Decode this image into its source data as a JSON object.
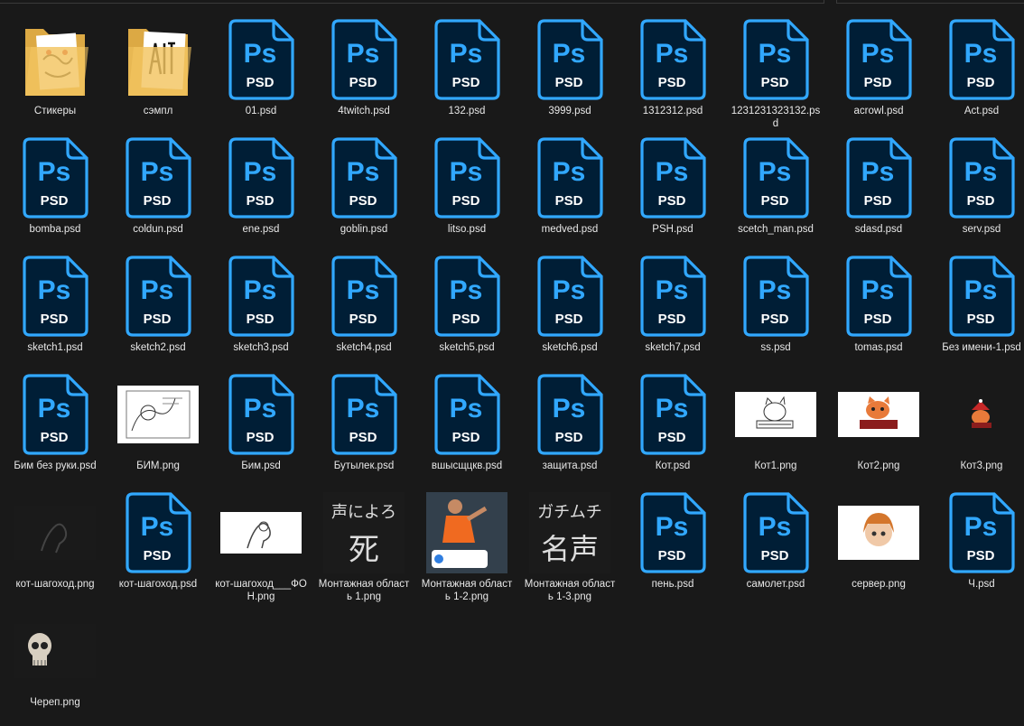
{
  "items": [
    {
      "kind": "folder",
      "variant": "stickers",
      "name": "Стикеры"
    },
    {
      "kind": "folder",
      "variant": "sample",
      "name": "сэмпл"
    },
    {
      "kind": "psd",
      "name": "01.psd"
    },
    {
      "kind": "psd",
      "name": "4twitch.psd"
    },
    {
      "kind": "psd",
      "name": "132.psd"
    },
    {
      "kind": "psd",
      "name": "3999.psd"
    },
    {
      "kind": "psd",
      "name": "1312312.psd"
    },
    {
      "kind": "psd",
      "name": "1231231323132.psd"
    },
    {
      "kind": "psd",
      "name": "acrowl.psd"
    },
    {
      "kind": "psd",
      "name": "Act.psd"
    },
    {
      "kind": "psd",
      "name": "bomba.psd"
    },
    {
      "kind": "psd",
      "name": "coldun.psd"
    },
    {
      "kind": "psd",
      "name": "ene.psd"
    },
    {
      "kind": "psd",
      "name": "goblin.psd"
    },
    {
      "kind": "psd",
      "name": "litso.psd"
    },
    {
      "kind": "psd",
      "name": "medved.psd"
    },
    {
      "kind": "psd",
      "name": "PSH.psd"
    },
    {
      "kind": "psd",
      "name": "scetch_man.psd"
    },
    {
      "kind": "psd",
      "name": "sdasd.psd"
    },
    {
      "kind": "psd",
      "name": "serv.psd"
    },
    {
      "kind": "psd",
      "name": "sketch1.psd"
    },
    {
      "kind": "psd",
      "name": "sketch2.psd"
    },
    {
      "kind": "psd",
      "name": "sketch3.psd"
    },
    {
      "kind": "psd",
      "name": "sketch4.psd"
    },
    {
      "kind": "psd",
      "name": "sketch5.psd"
    },
    {
      "kind": "psd",
      "name": "sketch6.psd"
    },
    {
      "kind": "psd",
      "name": "sketch7.psd"
    },
    {
      "kind": "psd",
      "name": "ss.psd"
    },
    {
      "kind": "psd",
      "name": "tomas.psd"
    },
    {
      "kind": "psd",
      "name": "Без имени-1.psd"
    },
    {
      "kind": "psd",
      "name": "Бим без руки.psd"
    },
    {
      "kind": "image",
      "variant": "bim",
      "name": "БИМ.png"
    },
    {
      "kind": "psd",
      "name": "Бим.psd"
    },
    {
      "kind": "psd",
      "name": "Бутылек.psd"
    },
    {
      "kind": "psd",
      "name": "вшысщцкв.psd"
    },
    {
      "kind": "psd",
      "name": "защита.psd"
    },
    {
      "kind": "psd",
      "name": "Кот.psd"
    },
    {
      "kind": "image",
      "variant": "cat1",
      "name": "Кот1.png"
    },
    {
      "kind": "image",
      "variant": "cat2",
      "name": "Кот2.png"
    },
    {
      "kind": "image",
      "variant": "cat3",
      "name": "Кот3.png"
    },
    {
      "kind": "image",
      "variant": "walker",
      "name": "кот-шагоход.png"
    },
    {
      "kind": "psd",
      "name": "кот-шагоход.psd"
    },
    {
      "kind": "image",
      "variant": "walker-bg",
      "name": "кот-шагоход___ФОН.png"
    },
    {
      "kind": "image",
      "variant": "artboard1",
      "name": "Монтажная область 1.png"
    },
    {
      "kind": "image",
      "variant": "artboard2",
      "name": "Монтажная область 1-2.png"
    },
    {
      "kind": "image",
      "variant": "artboard3",
      "name": "Монтажная область 1-3.png"
    },
    {
      "kind": "psd",
      "name": "пень.psd"
    },
    {
      "kind": "psd",
      "name": "самолет.psd"
    },
    {
      "kind": "image",
      "variant": "server",
      "name": "сервер.png"
    },
    {
      "kind": "psd",
      "name": "Ч.psd"
    },
    {
      "kind": "image",
      "variant": "skull",
      "name": "Череп.png"
    }
  ],
  "artboard_text": {
    "a1_top": "声によろ",
    "a1_big": "死",
    "a3_top": "ガチムチ",
    "a3_big": "名声"
  },
  "icon_texts": {
    "ps": "Ps",
    "psd": "PSD"
  },
  "colors": {
    "background": "#191919",
    "psd_fill": "#001e36",
    "psd_accent": "#31a8ff",
    "folder": "#f3c561",
    "label": "#e8e8e8"
  }
}
